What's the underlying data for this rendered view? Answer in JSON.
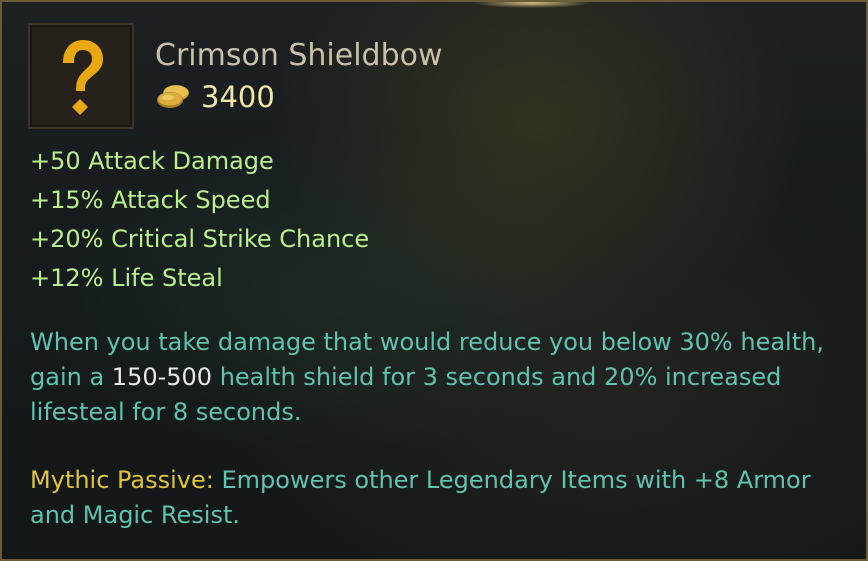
{
  "item": {
    "name": "Crimson Shieldbow",
    "cost": "3400",
    "icon": "question-mark-icon",
    "gold_icon": "gold-coins-icon"
  },
  "stats": [
    "+50 Attack Damage",
    "+15% Attack Speed",
    "+20% Critical Strike Chance",
    "+12% Life Steal"
  ],
  "description": {
    "part1": "When you take damage that would reduce you below 30% health, gain a ",
    "highlight": "150-500",
    "part2": " health shield for 3 seconds and 20% increased lifesteal for 8 seconds."
  },
  "mythic": {
    "label": "Mythic Passive:",
    "text": " Empowers other Legendary Items with +8 Armor and Magic Resist."
  },
  "colors": {
    "stat_green": "#b9ef8c",
    "description_teal": "#5fc3b0",
    "mythic_gold": "#e0c43c",
    "cost_gold": "#f0e6a8",
    "icon_gold": "#e8a910"
  }
}
